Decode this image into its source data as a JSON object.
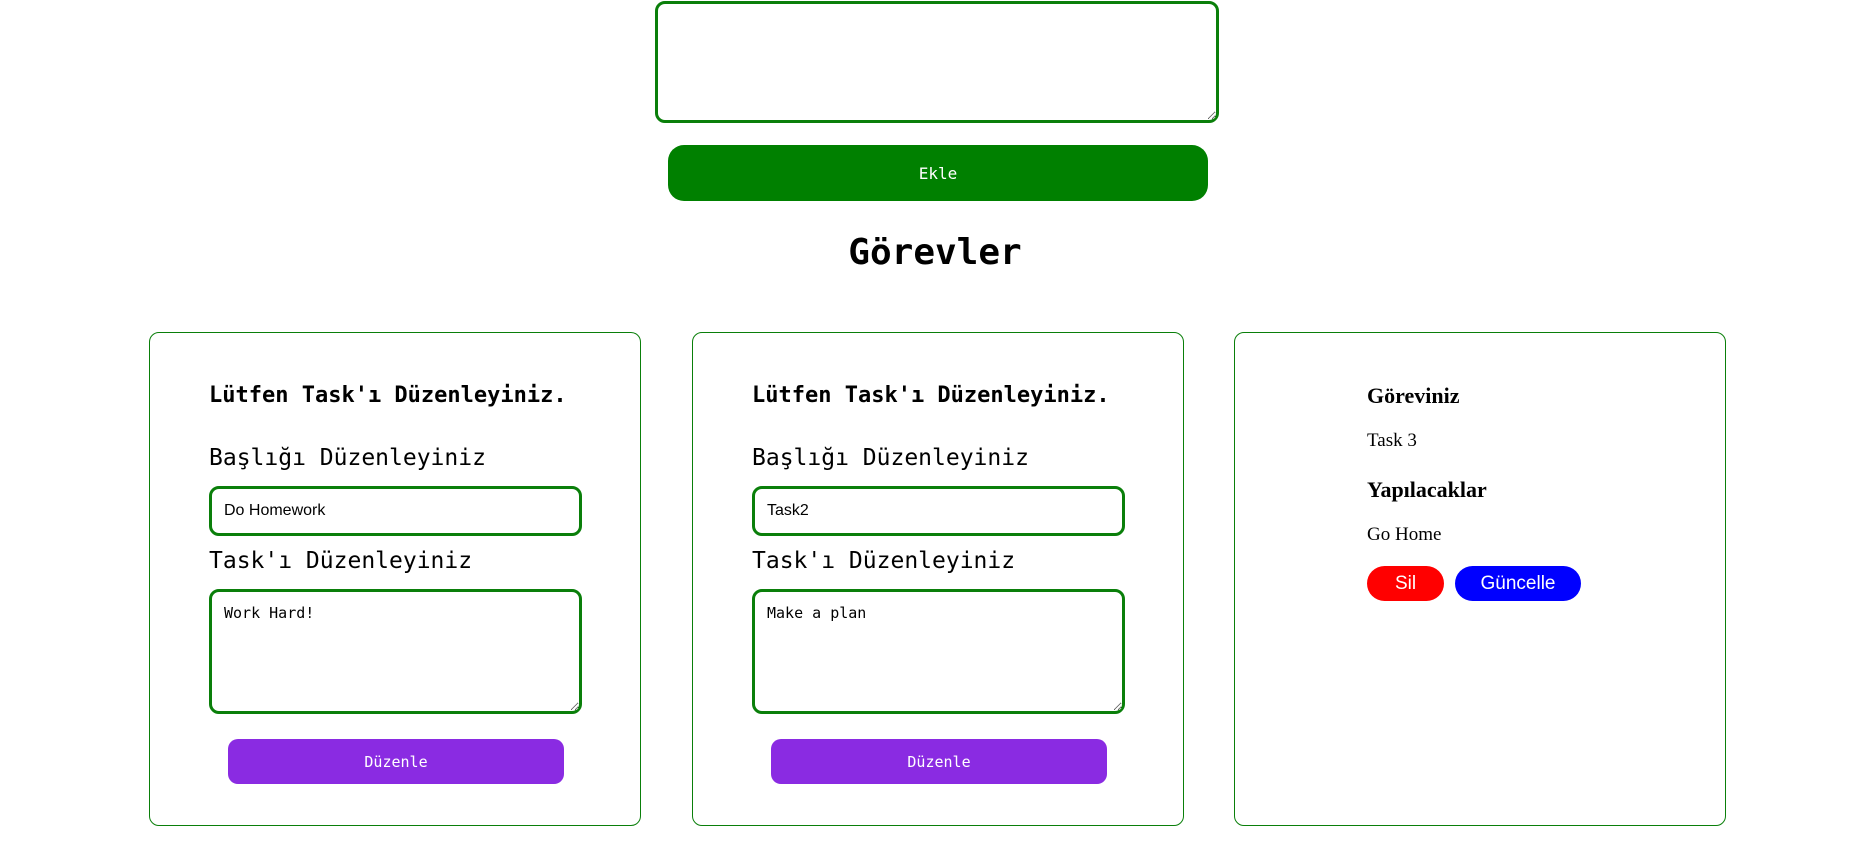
{
  "add_form": {
    "textarea_value": "",
    "add_button_label": "Ekle"
  },
  "section_title": "Görevler",
  "edit_cards": [
    {
      "heading": "Lütfen Task'ı Düzenleyiniz.",
      "title_label": "Başlığı Düzenleyiniz",
      "title_value": "Do Homework",
      "task_label": "Task'ı Düzenleyiniz",
      "task_value": "Work Hard!",
      "button_label": "Düzenle"
    },
    {
      "heading": "Lütfen Task'ı Düzenleyiniz.",
      "title_label": "Başlığı Düzenleyiniz",
      "title_value": "Task2",
      "task_label": "Task'ı Düzenleyiniz",
      "task_value": "Make a plan",
      "button_label": "Düzenle"
    }
  ],
  "view_card": {
    "task_heading": "Göreviniz",
    "task_value": "Task 3",
    "todo_heading": "Yapılacaklar",
    "todo_value": "Go Home",
    "delete_label": "Sil",
    "update_label": "Güncelle"
  },
  "colors": {
    "accent_green": "#008000",
    "border_green": "#0a7f0a",
    "edit_purple": "#8a2be2",
    "delete_red": "#ff0000",
    "update_blue": "#0000ff"
  }
}
